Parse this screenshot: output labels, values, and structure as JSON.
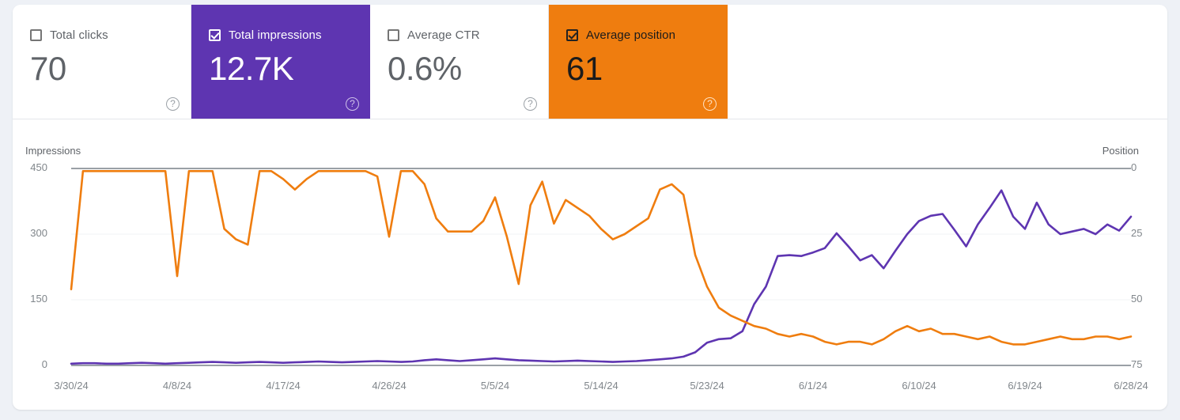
{
  "metrics": [
    {
      "label": "Total clicks",
      "value": "70",
      "checked": false,
      "selected": false,
      "help": "?"
    },
    {
      "label": "Total impressions",
      "value": "12.7K",
      "checked": true,
      "selected": true,
      "help": "?"
    },
    {
      "label": "Average CTR",
      "value": "0.6%",
      "checked": false,
      "selected": false,
      "help": "?"
    },
    {
      "label": "Average position",
      "value": "61",
      "checked": true,
      "selected": true,
      "help": "?"
    }
  ],
  "colors": {
    "impressions": "#5e35b1",
    "position": "#ef7d0f",
    "grid": "#f1f3f4",
    "axis": "#9aa0a6",
    "tick_text": "#80868b",
    "card_bg": "#ffffff",
    "page_bg": "#eef1f6"
  },
  "chart_data": {
    "type": "line",
    "title": "",
    "xlabel": "",
    "grid": true,
    "legend": "none",
    "axes": {
      "left": {
        "label": "Impressions",
        "ticks": [
          "0",
          "150",
          "300",
          "450"
        ],
        "min": 0,
        "max": 450
      },
      "right": {
        "label": "Position",
        "ticks": [
          "0",
          "25",
          "50",
          "75"
        ],
        "min": 0,
        "max": 75,
        "inverted": true
      }
    },
    "x_tick_labels": [
      "3/30/24",
      "4/8/24",
      "4/17/24",
      "4/26/24",
      "5/5/24",
      "5/14/24",
      "5/23/24",
      "6/1/24",
      "6/10/24",
      "6/19/24",
      "6/28/24"
    ],
    "x_tick_indices": [
      0,
      9,
      18,
      27,
      36,
      45,
      54,
      63,
      72,
      81,
      90
    ],
    "x_start": "3/30/24",
    "x_end": "6/28/24",
    "n_points": 91,
    "series": [
      {
        "name": "Total impressions",
        "axis": "left",
        "color": "#5e35b1",
        "ylim": [
          0,
          450
        ],
        "values": [
          4,
          5,
          5,
          4,
          4,
          5,
          6,
          5,
          4,
          5,
          6,
          7,
          8,
          7,
          6,
          7,
          8,
          7,
          6,
          7,
          8,
          9,
          8,
          7,
          8,
          9,
          10,
          9,
          8,
          9,
          12,
          14,
          12,
          10,
          12,
          14,
          16,
          14,
          12,
          11,
          10,
          9,
          10,
          11,
          10,
          9,
          8,
          9,
          10,
          12,
          14,
          16,
          20,
          30,
          52,
          60,
          62,
          78,
          140,
          180,
          250,
          252,
          250,
          258,
          268,
          302,
          272,
          240,
          252,
          222,
          262,
          300,
          330,
          342,
          346,
          310,
          272,
          322,
          360,
          400,
          340,
          312,
          372,
          322,
          300,
          306,
          312,
          300,
          322,
          308,
          340
        ]
      },
      {
        "name": "Average position",
        "axis": "right",
        "color": "#ef7d0f",
        "ylim": [
          0,
          75
        ],
        "note": "position axis is inverted (0 at top)",
        "values": [
          46,
          1,
          1,
          1,
          1,
          1,
          1,
          1,
          1,
          41,
          1,
          1,
          1,
          23,
          27,
          29,
          1,
          1,
          4,
          8,
          4,
          1,
          1,
          1,
          1,
          1,
          3,
          26,
          1,
          1,
          6,
          19,
          24,
          24,
          24,
          20,
          11,
          26,
          44,
          14,
          5,
          21,
          12,
          15,
          18,
          23,
          27,
          25,
          22,
          19,
          8,
          6,
          10,
          33,
          45,
          53,
          56,
          58,
          60,
          61,
          63,
          64,
          63,
          64,
          66,
          67,
          66,
          66,
          67,
          65,
          62,
          60,
          62,
          61,
          63,
          63,
          64,
          65,
          64,
          66,
          67,
          67,
          66,
          65,
          64,
          65,
          65,
          64,
          64,
          65,
          64
        ]
      }
    ]
  }
}
